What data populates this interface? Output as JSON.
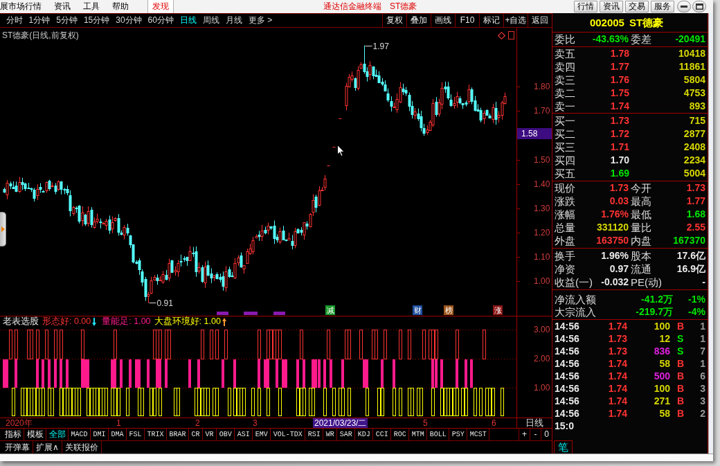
{
  "menu_bar": {
    "items": [
      {
        "label": "展市场行情",
        "highlighted": false
      },
      {
        "label": "资讯",
        "highlighted": false
      },
      {
        "label": "工具",
        "highlighted": false
      },
      {
        "label": "帮助",
        "highlighted": false
      },
      {
        "label": "发现",
        "highlighted": true
      }
    ],
    "app_title": "通达信金融终端",
    "stock_title": "ST德豪",
    "buttons": [
      "行情",
      "资讯",
      "交易",
      "服务"
    ]
  },
  "period_bar": {
    "periods": [
      {
        "label": "分时",
        "selected": false
      },
      {
        "label": "1分钟",
        "selected": false
      },
      {
        "label": "5分钟",
        "selected": false
      },
      {
        "label": "15分钟",
        "selected": false
      },
      {
        "label": "30分钟",
        "selected": false
      },
      {
        "label": "60分钟",
        "selected": false
      },
      {
        "label": "日线",
        "selected": true
      },
      {
        "label": "周线",
        "selected": false
      },
      {
        "label": "月线",
        "selected": false
      }
    ],
    "more": "更多 >",
    "actions": [
      "复权",
      "叠加",
      "画线",
      "F10",
      "标记",
      "+自选",
      "返回"
    ]
  },
  "chart": {
    "title": "ST德豪(日线,前复权)",
    "price_ticks": [
      "1.80",
      "1.70",
      "1.50",
      "1.40",
      "1.30",
      "1.20",
      "1.10",
      "1.00"
    ],
    "cursor_price": "1.58",
    "high_label": "1.97",
    "low_label": "0.91",
    "event_tags": [
      {
        "label": "减",
        "color": "#1a9a2a"
      },
      {
        "label": "财",
        "color": "#1f4f9f"
      },
      {
        "label": "榜",
        "color": "#a0581c"
      },
      {
        "label": "涨",
        "color": "#8c1414"
      }
    ]
  },
  "indicator": {
    "name": "老表选股",
    "lines": [
      {
        "label": "形态好: 0.00",
        "color": "#ff3232",
        "arrow": {
          "kind": "down",
          "color": "#20e0f0"
        }
      },
      {
        "label": "量能足: 1.00",
        "color": "#ff1a8c"
      },
      {
        "label": "大盘环境好: 1.00",
        "color": "#ffff00",
        "arrow": {
          "kind": "up",
          "color": "#ff9a30"
        }
      }
    ],
    "axis_ticks": [
      "3.00",
      "2.00",
      "1.00"
    ]
  },
  "date_axis": {
    "labels": [
      {
        "label": "2020年",
        "selected": false
      },
      {
        "label": "1",
        "selected": false
      },
      {
        "label": "2",
        "selected": false
      },
      {
        "label": "3",
        "selected": false
      },
      {
        "label": "2021/03/23/二",
        "selected": true
      },
      {
        "label": "5",
        "selected": false
      },
      {
        "label": "6",
        "selected": false
      }
    ],
    "period": "日线"
  },
  "indicator_tabs": {
    "items": [
      {
        "label": "指标",
        "kind": "group",
        "selected": false
      },
      {
        "label": "模板",
        "kind": "group",
        "selected": false
      },
      {
        "label": "全部",
        "kind": "indicator",
        "selected": true
      },
      {
        "label": "MACD",
        "kind": "indicator",
        "selected": false
      },
      {
        "label": "DMI",
        "kind": "indicator",
        "selected": false
      },
      {
        "label": "DMA",
        "kind": "indicator",
        "selected": false
      },
      {
        "label": "FSL",
        "kind": "indicator",
        "selected": false
      },
      {
        "label": "TRIX",
        "kind": "indicator",
        "selected": false
      },
      {
        "label": "BRAR",
        "kind": "indicator",
        "selected": false
      },
      {
        "label": "CR",
        "kind": "indicator",
        "selected": false
      },
      {
        "label": "VR",
        "kind": "indicator",
        "selected": false
      },
      {
        "label": "OBV",
        "kind": "indicator",
        "selected": false
      },
      {
        "label": "ASI",
        "kind": "indicator",
        "selected": false
      },
      {
        "label": "EMV",
        "kind": "indicator",
        "selected": false
      },
      {
        "label": "VOL-TDX",
        "kind": "indicator",
        "selected": false
      },
      {
        "label": "RSI",
        "kind": "indicator",
        "selected": false
      },
      {
        "label": "WR",
        "kind": "indicator",
        "selected": false
      },
      {
        "label": "SAR",
        "kind": "indicator",
        "selected": false
      },
      {
        "label": "KDJ",
        "kind": "indicator",
        "selected": false
      },
      {
        "label": "CCI",
        "kind": "indicator",
        "selected": false
      },
      {
        "label": "ROC",
        "kind": "indicator",
        "selected": false
      },
      {
        "label": "MTM",
        "kind": "indicator",
        "selected": false
      },
      {
        "label": "BOLL",
        "kind": "indicator",
        "selected": false
      },
      {
        "label": "PSY",
        "kind": "indicator",
        "selected": false
      },
      {
        "label": "MCST",
        "kind": "indicator",
        "selected": false
      }
    ],
    "controls": [
      "+",
      "-",
      "0"
    ]
  },
  "bottom_links": [
    "开弹幕",
    "扩展∧",
    "关联报价"
  ],
  "quote_panel": {
    "code": "002005",
    "name": "ST德豪",
    "summary": [
      {
        "label": "委比",
        "value": "-43.63%",
        "color": "#00e600"
      },
      {
        "label": "委差",
        "value": "-20491",
        "color": "#00e600"
      }
    ],
    "asks": [
      {
        "label": "卖五",
        "price": "1.78",
        "color": "#ff3232",
        "volume": "10418"
      },
      {
        "label": "卖四",
        "price": "1.77",
        "color": "#ff3232",
        "volume": "11861"
      },
      {
        "label": "卖三",
        "price": "1.76",
        "color": "#ff3232",
        "volume": "5804"
      },
      {
        "label": "卖二",
        "price": "1.75",
        "color": "#ff3232",
        "volume": "4753"
      },
      {
        "label": "卖一",
        "price": "1.74",
        "color": "#ff3232",
        "volume": "893"
      }
    ],
    "bids": [
      {
        "label": "买一",
        "price": "1.73",
        "color": "#ff3232",
        "volume": "715"
      },
      {
        "label": "买二",
        "price": "1.72",
        "color": "#ff3232",
        "volume": "2877"
      },
      {
        "label": "买三",
        "price": "1.71",
        "color": "#ff3232",
        "volume": "2408"
      },
      {
        "label": "买四",
        "price": "1.70",
        "color": "#eaeaea",
        "volume": "2234"
      },
      {
        "label": "买五",
        "price": "1.69",
        "color": "#00e600",
        "volume": "5004"
      }
    ],
    "stats": [
      {
        "label": "现价",
        "value": "1.73",
        "color": "#ff3232"
      },
      {
        "label": "今开",
        "value": "1.73",
        "color": "#ff3232"
      },
      {
        "label": "涨跌",
        "value": "0.03",
        "color": "#ff3232"
      },
      {
        "label": "最高",
        "value": "1.77",
        "color": "#ff3232"
      },
      {
        "label": "涨幅",
        "value": "1.76%",
        "color": "#ff3232"
      },
      {
        "label": "最低",
        "value": "1.68",
        "color": "#00e600"
      },
      {
        "label": "总量",
        "value": "331120",
        "color": "#d8d800"
      },
      {
        "label": "量比",
        "value": "2.55",
        "color": "#ff3232"
      },
      {
        "label": "外盘",
        "value": "163750",
        "color": "#ff3232"
      },
      {
        "label": "内盘",
        "value": "167370",
        "color": "#00e600"
      }
    ],
    "fundamentals": [
      {
        "label": "换手",
        "value": "1.96%"
      },
      {
        "label": "股本",
        "value": "17.6亿"
      },
      {
        "label": "净资",
        "value": "0.97"
      },
      {
        "label": "流通",
        "value": "16.9亿"
      },
      {
        "label": "收益(一)",
        "value": "-0.032"
      },
      {
        "label": "PE(动)",
        "value": "-"
      }
    ],
    "flows": [
      {
        "label": "净流入额",
        "amount": "-41.2万",
        "share": "-1%",
        "color": "#00e600"
      },
      {
        "label": "大宗流入",
        "amount": "-219.7万",
        "share": "-4%",
        "color": "#00e600"
      }
    ],
    "trades": [
      {
        "time": "14:56",
        "price": "1.74",
        "color": "#ff3232",
        "volume": "100",
        "large": false,
        "side": "B",
        "kind": "buy",
        "count": "1"
      },
      {
        "time": "14:56",
        "price": "1.73",
        "color": "#ff3232",
        "volume": "12",
        "large": false,
        "side": "S",
        "kind": "sell",
        "count": "1"
      },
      {
        "time": "14:56",
        "price": "1.73",
        "color": "#ff3232",
        "volume": "836",
        "large": true,
        "side": "S",
        "kind": "sell",
        "count": "7"
      },
      {
        "time": "14:56",
        "price": "1.74",
        "color": "#ff3232",
        "volume": "58",
        "large": false,
        "side": "B",
        "kind": "buy",
        "count": "1"
      },
      {
        "time": "14:56",
        "price": "1.74",
        "color": "#ff3232",
        "volume": "500",
        "large": true,
        "side": "B",
        "kind": "buy",
        "count": "6"
      },
      {
        "time": "14:56",
        "price": "1.74",
        "color": "#ff3232",
        "volume": "100",
        "large": false,
        "side": "B",
        "kind": "buy",
        "count": "3"
      },
      {
        "time": "14:56",
        "price": "1.74",
        "color": "#ff3232",
        "volume": "271",
        "large": false,
        "side": "B",
        "kind": "buy",
        "count": "3"
      },
      {
        "time": "14:56",
        "price": "1.74",
        "color": "#ff3232",
        "volume": "58",
        "large": false,
        "side": "B",
        "kind": "buy",
        "count": "2"
      },
      {
        "time": "15:0"
      }
    ],
    "tabs": [
      {
        "label": "笔",
        "selected": true
      }
    ]
  }
}
